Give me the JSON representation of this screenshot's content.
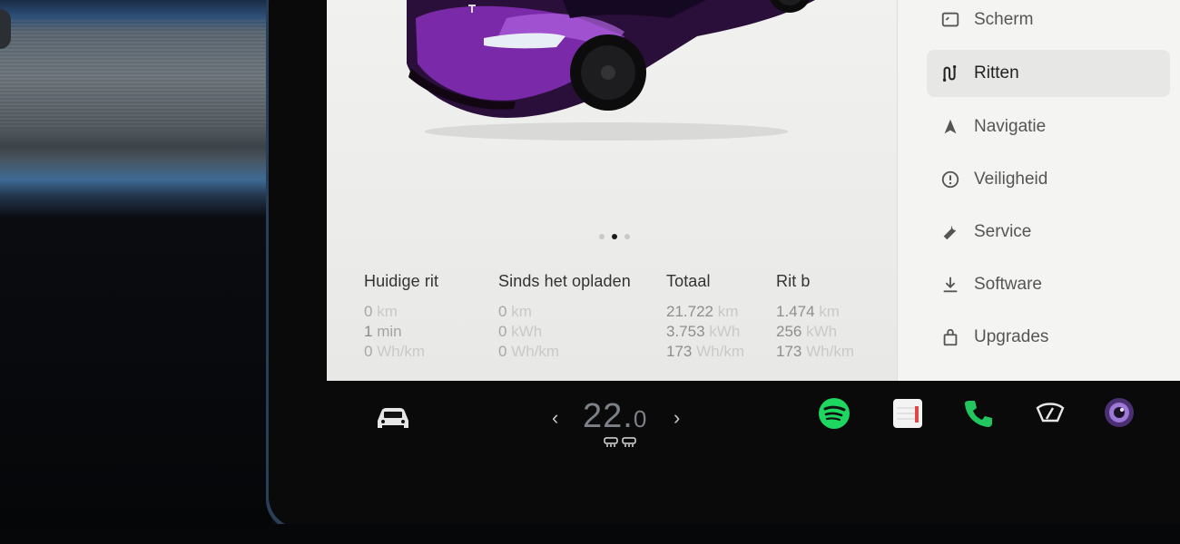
{
  "menu": {
    "items": [
      {
        "label": "Scherm",
        "icon": "display-icon"
      },
      {
        "label": "Ritten",
        "icon": "trips-icon",
        "selected": true
      },
      {
        "label": "Navigatie",
        "icon": "navigation-arrow-icon"
      },
      {
        "label": "Veiligheid",
        "icon": "safety-icon"
      },
      {
        "label": "Service",
        "icon": "wrench-icon"
      },
      {
        "label": "Software",
        "icon": "download-icon"
      },
      {
        "label": "Upgrades",
        "icon": "shopping-bag-icon"
      }
    ]
  },
  "carousel": {
    "count": 3,
    "active": 1
  },
  "trips": [
    {
      "title": "Huidige rit",
      "rows": [
        {
          "value": "0",
          "unit": "km"
        },
        {
          "value": "1",
          "unit": "min"
        },
        {
          "value": "0",
          "unit": "Wh/km"
        }
      ]
    },
    {
      "title": "Sinds het opladen",
      "rows": [
        {
          "value": "0",
          "unit": "km"
        },
        {
          "value": "0",
          "unit": "kWh"
        },
        {
          "value": "0",
          "unit": "Wh/km"
        }
      ]
    },
    {
      "title": "Totaal",
      "rows": [
        {
          "value": "21.722",
          "unit": "km"
        },
        {
          "value": "3.753",
          "unit": "kWh"
        },
        {
          "value": "173",
          "unit": "Wh/km"
        }
      ]
    },
    {
      "title": "Rit b",
      "rows": [
        {
          "value": "1.474",
          "unit": "km"
        },
        {
          "value": "256",
          "unit": "kWh"
        },
        {
          "value": "173",
          "unit": "Wh/km"
        }
      ]
    }
  ],
  "taskbar": {
    "temperature": {
      "whole": "22.",
      "decimal": "0"
    },
    "icons": [
      "car-icon",
      "spotify-icon",
      "calendar-icon",
      "phone-icon",
      "wiper-icon",
      "camera-icon"
    ]
  },
  "colors": {
    "spotify": "#1ed760",
    "phone": "#22c55e",
    "car_paint": "#7a2aa8"
  }
}
